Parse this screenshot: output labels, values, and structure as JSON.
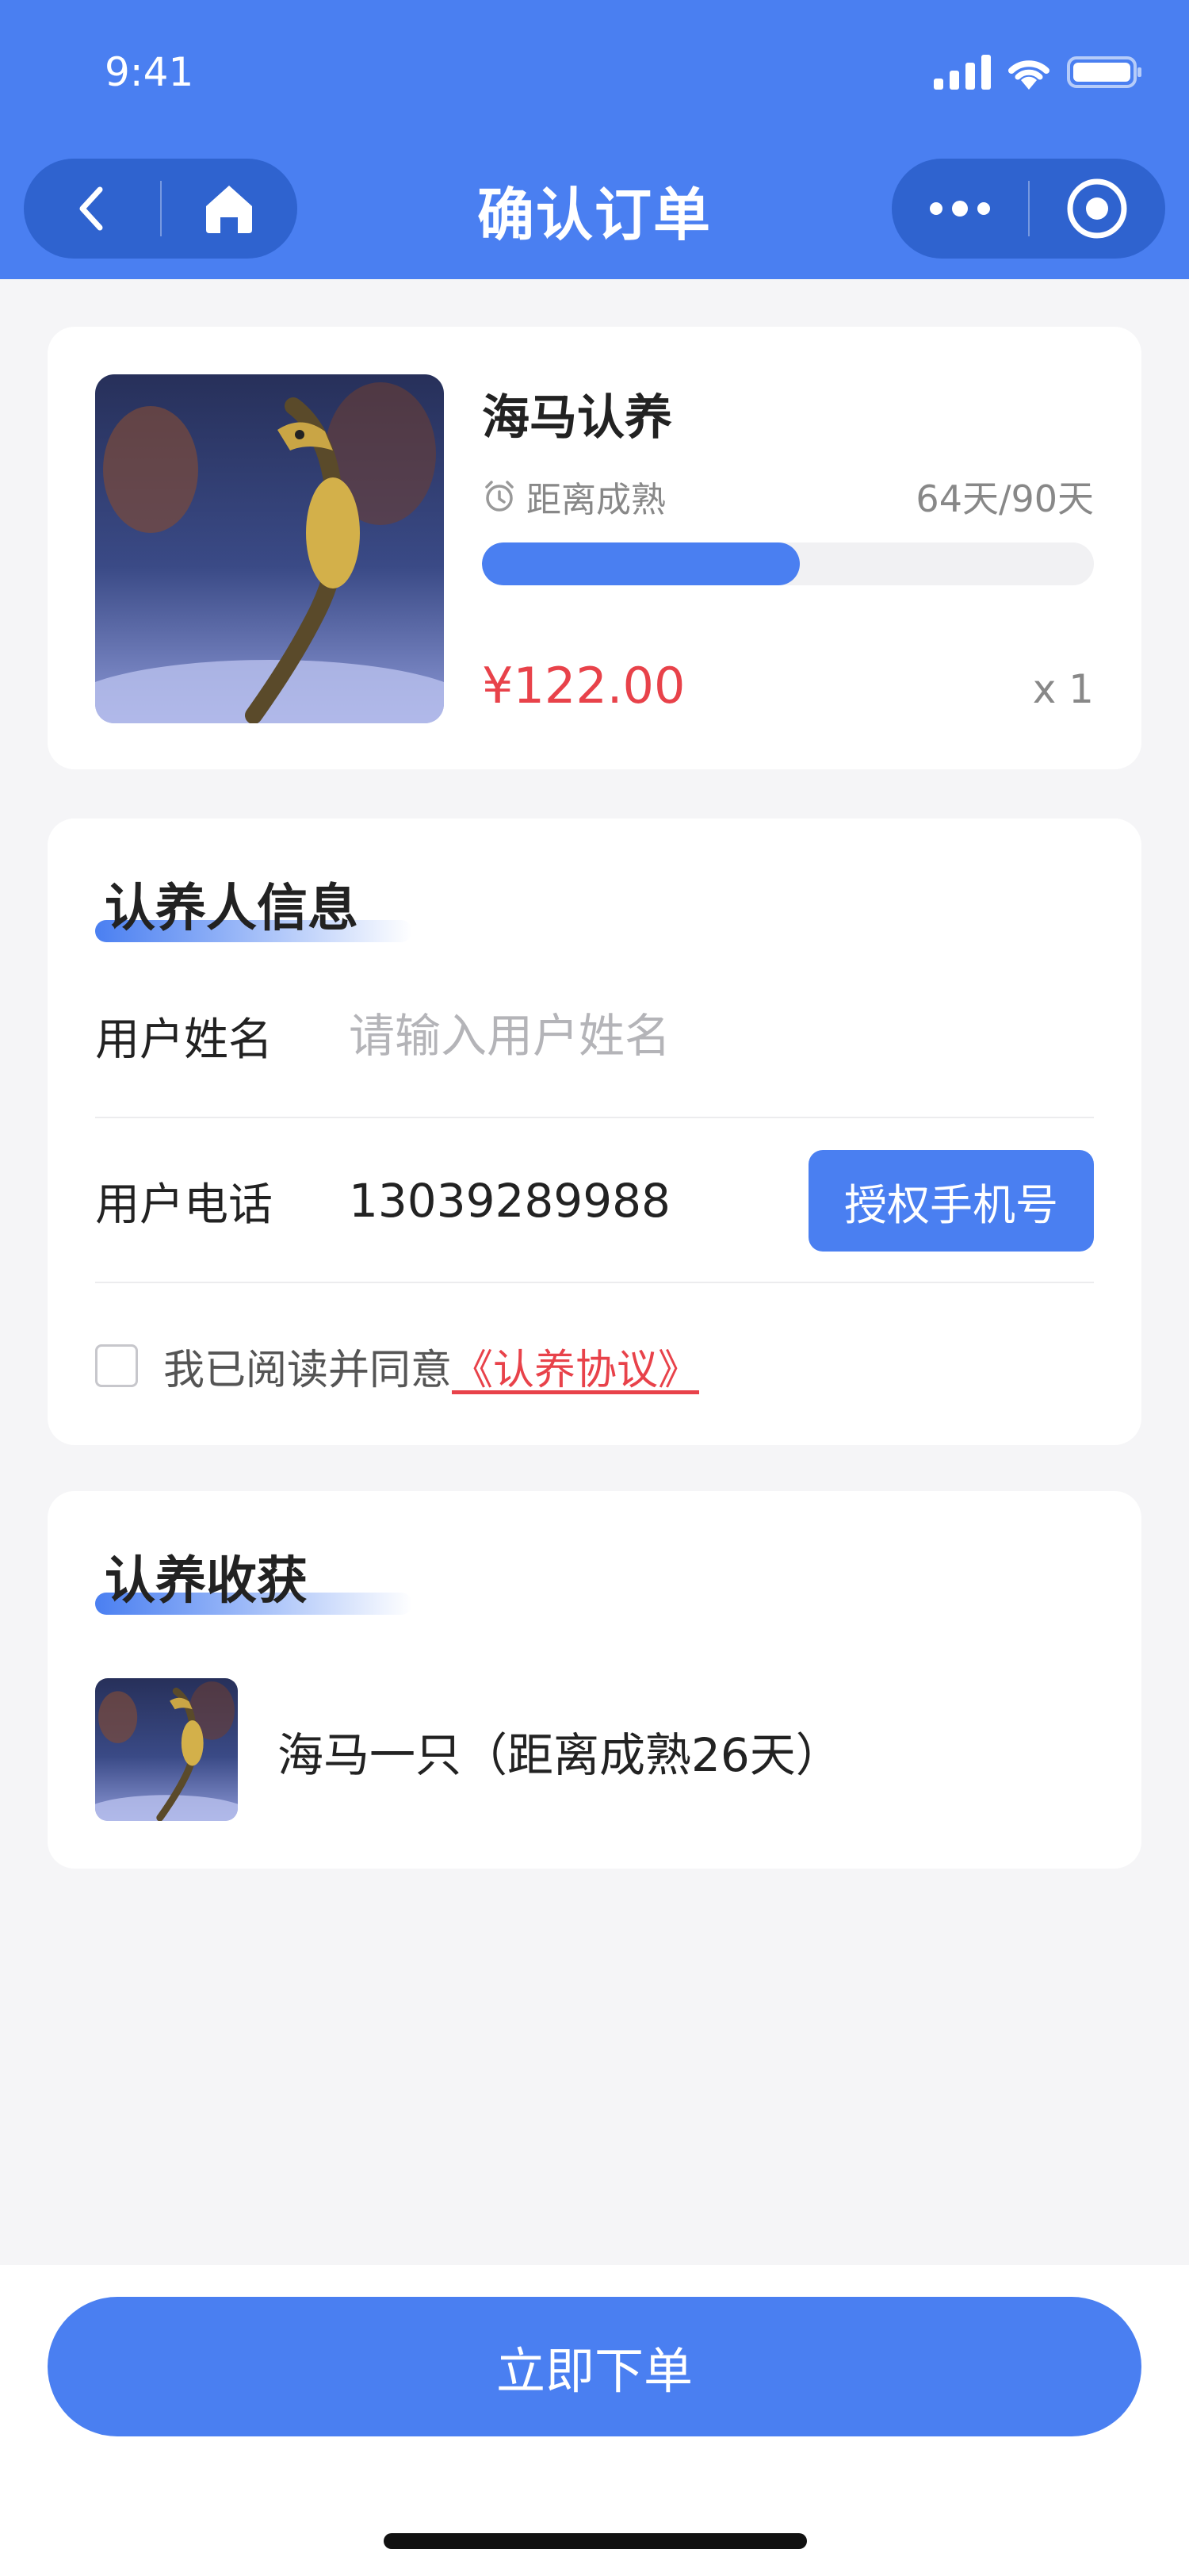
{
  "status_bar": {
    "time": "9:41",
    "icons": [
      "signal-icon",
      "wifi-icon",
      "battery-icon"
    ]
  },
  "nav": {
    "title": "确认订单",
    "left_icons": [
      "back-icon",
      "home-icon"
    ],
    "right_icons": [
      "more-icon",
      "close-target-icon"
    ]
  },
  "product": {
    "name": "海马认养",
    "mature_label": "距离成熟",
    "mature_days": "64天/90天",
    "progress": 0.52,
    "price": "¥122.00",
    "quantity": "x 1"
  },
  "adopter_info": {
    "section_title": "认养人信息",
    "name_label": "用户姓名",
    "name_placeholder": "请输入用户姓名",
    "name_value": "",
    "phone_label": "用户电话",
    "phone_value": "13039289988",
    "auth_button": "授权手机号",
    "agree_text": "我已阅读并同意",
    "agreement_link": "《认养协议》",
    "agree_checked": false
  },
  "harvest": {
    "section_title": "认养收获",
    "item_text": "海马一只（距离成熟26天）"
  },
  "footer": {
    "order_button": "立即下单"
  },
  "colors": {
    "primary": "#4a7ff1",
    "capsule": "#2f63cf",
    "price": "#e8424a",
    "background": "#f5f5f7"
  }
}
